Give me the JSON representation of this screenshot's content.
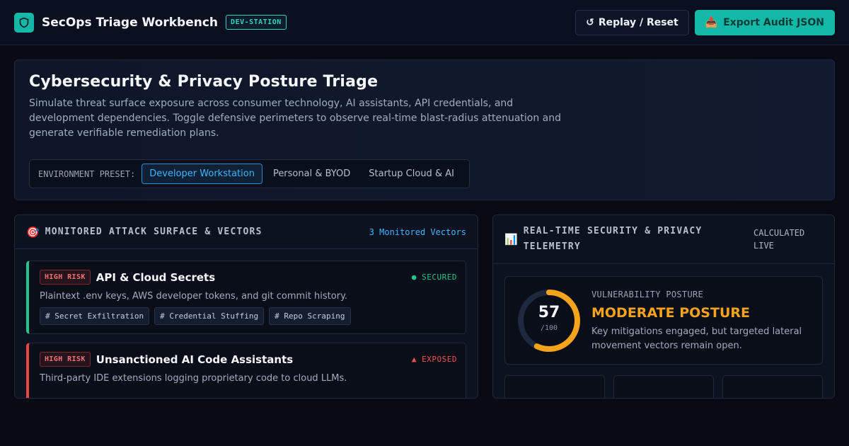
{
  "header": {
    "logo_icon": "shield-icon",
    "title": "SecOps Triage Workbench",
    "station_badge": "DEV-STATION",
    "replay_label": "Replay / Reset",
    "replay_icon": "↺",
    "export_label": "Export Audit JSON",
    "export_icon": "📥"
  },
  "hero": {
    "title": "Cybersecurity & Privacy Posture Triage",
    "description": "Simulate threat surface exposure across consumer technology, AI assistants, API credentials, and development dependencies. Toggle defensive perimeters to observe real-time blast-radius attenuation and generate verifiable remediation plans.",
    "preset_label": "ENVIRONMENT PRESET:",
    "presets": [
      {
        "label": "Developer Workstation",
        "active": true
      },
      {
        "label": "Personal & BYOD",
        "active": false
      },
      {
        "label": "Startup Cloud & AI",
        "active": false
      }
    ]
  },
  "attack_surface": {
    "icon": "🎯",
    "title": "MONITORED ATTACK SURFACE & VECTORS",
    "count_label": "3 Monitored Vectors",
    "vectors": [
      {
        "risk": "HIGH RISK",
        "title": "API & Cloud Secrets",
        "status": "● SECURED",
        "description": "Plaintext .env keys, AWS developer tokens, and git commit history.",
        "tags": [
          "# Secret Exfiltration",
          "# Credential Stuffing",
          "# Repo Scraping"
        ]
      },
      {
        "risk": "HIGH RISK",
        "title": "Unsanctioned AI Code Assistants",
        "status": "▲ EXPOSED",
        "description": "Third-party IDE extensions logging proprietary code to cloud LLMs."
      }
    ]
  },
  "telemetry": {
    "icon": "📊",
    "title": "REAL-TIME SECURITY & PRIVACY TELEMETRY",
    "meta": "CALCULATED LIVE",
    "posture_label": "VULNERABILITY POSTURE",
    "score": "57",
    "score_max": "/100",
    "score_fraction": 0.57,
    "posture_value": "MODERATE POSTURE",
    "posture_desc": "Key mitigations engaged, but targeted lateral movement vectors remain open.",
    "colors": {
      "gauge": "#f5a31b",
      "gauge_track": "#1e2940"
    }
  }
}
